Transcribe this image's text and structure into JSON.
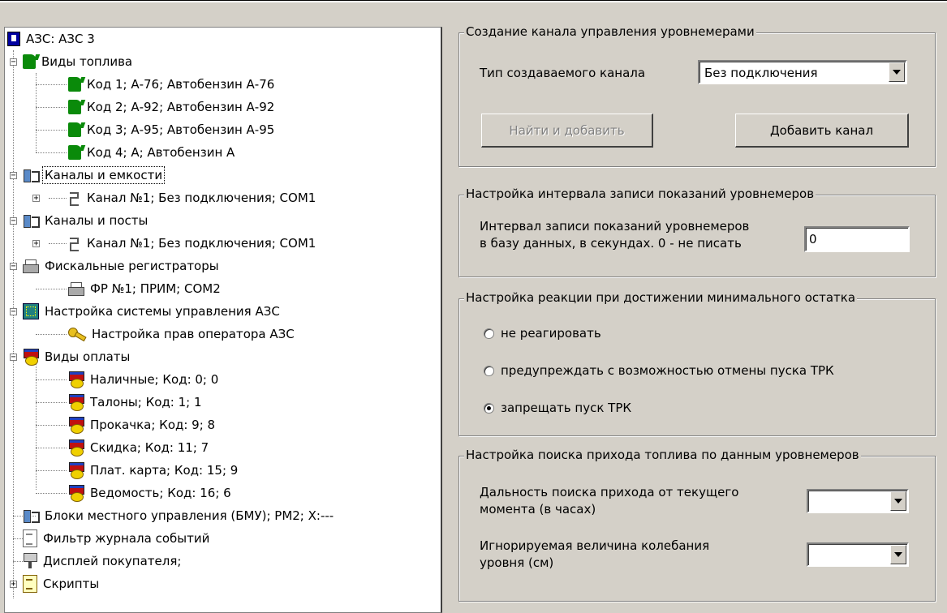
{
  "tree": {
    "items": [
      {
        "label": "АЗС: АЗС 3",
        "icon": "gas-station-icon"
      },
      {
        "label": "Виды топлива",
        "icon": "fuel-canister-icon"
      },
      {
        "label": "Код 1; А-76; Автобензин А-76",
        "icon": "fuel-canister-icon"
      },
      {
        "label": "Код 2; А-92; Автобензин А-92",
        "icon": "fuel-canister-icon"
      },
      {
        "label": "Код 3; А-95; Автобензин А-95",
        "icon": "fuel-canister-icon"
      },
      {
        "label": "Код 4; А; Автобензин А",
        "icon": "fuel-canister-icon"
      },
      {
        "label": "Каналы и емкости",
        "icon": "channel-icon",
        "selected": true
      },
      {
        "label": "Канал №1; Без подключения; COM1",
        "icon": "channel-hook-icon"
      },
      {
        "label": "Каналы и посты",
        "icon": "channel-icon"
      },
      {
        "label": "Канал №1; Без подключения; COM1",
        "icon": "channel-hook-icon"
      },
      {
        "label": "Фискальные регистраторы",
        "icon": "printer-icon"
      },
      {
        "label": "ФР №1; ПРИМ; COM2",
        "icon": "printer-icon"
      },
      {
        "label": "Настройка системы управления АЗС",
        "icon": "system-grid-icon"
      },
      {
        "label": "Настройка прав оператора АЗС",
        "icon": "key-icon"
      },
      {
        "label": "Виды оплаты",
        "icon": "payment-icon"
      },
      {
        "label": "Наличные; Код: 0; 0",
        "icon": "payment-icon"
      },
      {
        "label": "Талоны; Код: 1; 1",
        "icon": "payment-icon"
      },
      {
        "label": "Прокачка; Код: 9; 8",
        "icon": "payment-icon"
      },
      {
        "label": "Скидка; Код: 11; 7",
        "icon": "payment-icon"
      },
      {
        "label": "Плат. карта; Код: 15; 9",
        "icon": "payment-icon"
      },
      {
        "label": "Ведомость; Код: 16; 6",
        "icon": "payment-icon"
      },
      {
        "label": "Блоки местного управления (БМУ);  РМ2;  X:---",
        "icon": "channel-icon"
      },
      {
        "label": "Фильтр журнала событий",
        "icon": "filter-doc-icon"
      },
      {
        "label": "Дисплей покупателя;",
        "icon": "display-icon"
      },
      {
        "label": "Скрипты",
        "icon": "script-icon"
      }
    ]
  },
  "channel_group": {
    "title": "Создание канала управления уровнемерами",
    "type_label": "Тип создаваемого канала",
    "type_value": "Без подключения",
    "find_button": "Найти и добавить",
    "add_button": "Добавить канал"
  },
  "interval_group": {
    "title": "Настройка интервала записи показаний уровнемеров",
    "label_line1": "Интервал записи показаний уровнемеров",
    "label_line2": "в базу данных, в секундах. 0 - не писать",
    "value": "0"
  },
  "reaction_group": {
    "title": "Настройка реакции при достижении минимального остатка",
    "options": [
      {
        "label": "не реагировать",
        "checked": false
      },
      {
        "label": "предупреждать с возможностью отмены пуска ТРК",
        "checked": false
      },
      {
        "label": "запрещать пуск ТРК",
        "checked": true
      }
    ]
  },
  "search_group": {
    "title": "Настройка поиска прихода топлива по данным уровнемеров",
    "range_line1": "Дальность поиска прихода от текущего",
    "range_line2": "момента (в часах)",
    "range_value": "",
    "ignore_line1": "Игнорируемая величина колебания",
    "ignore_line2": "уровня (см)",
    "ignore_value": ""
  }
}
